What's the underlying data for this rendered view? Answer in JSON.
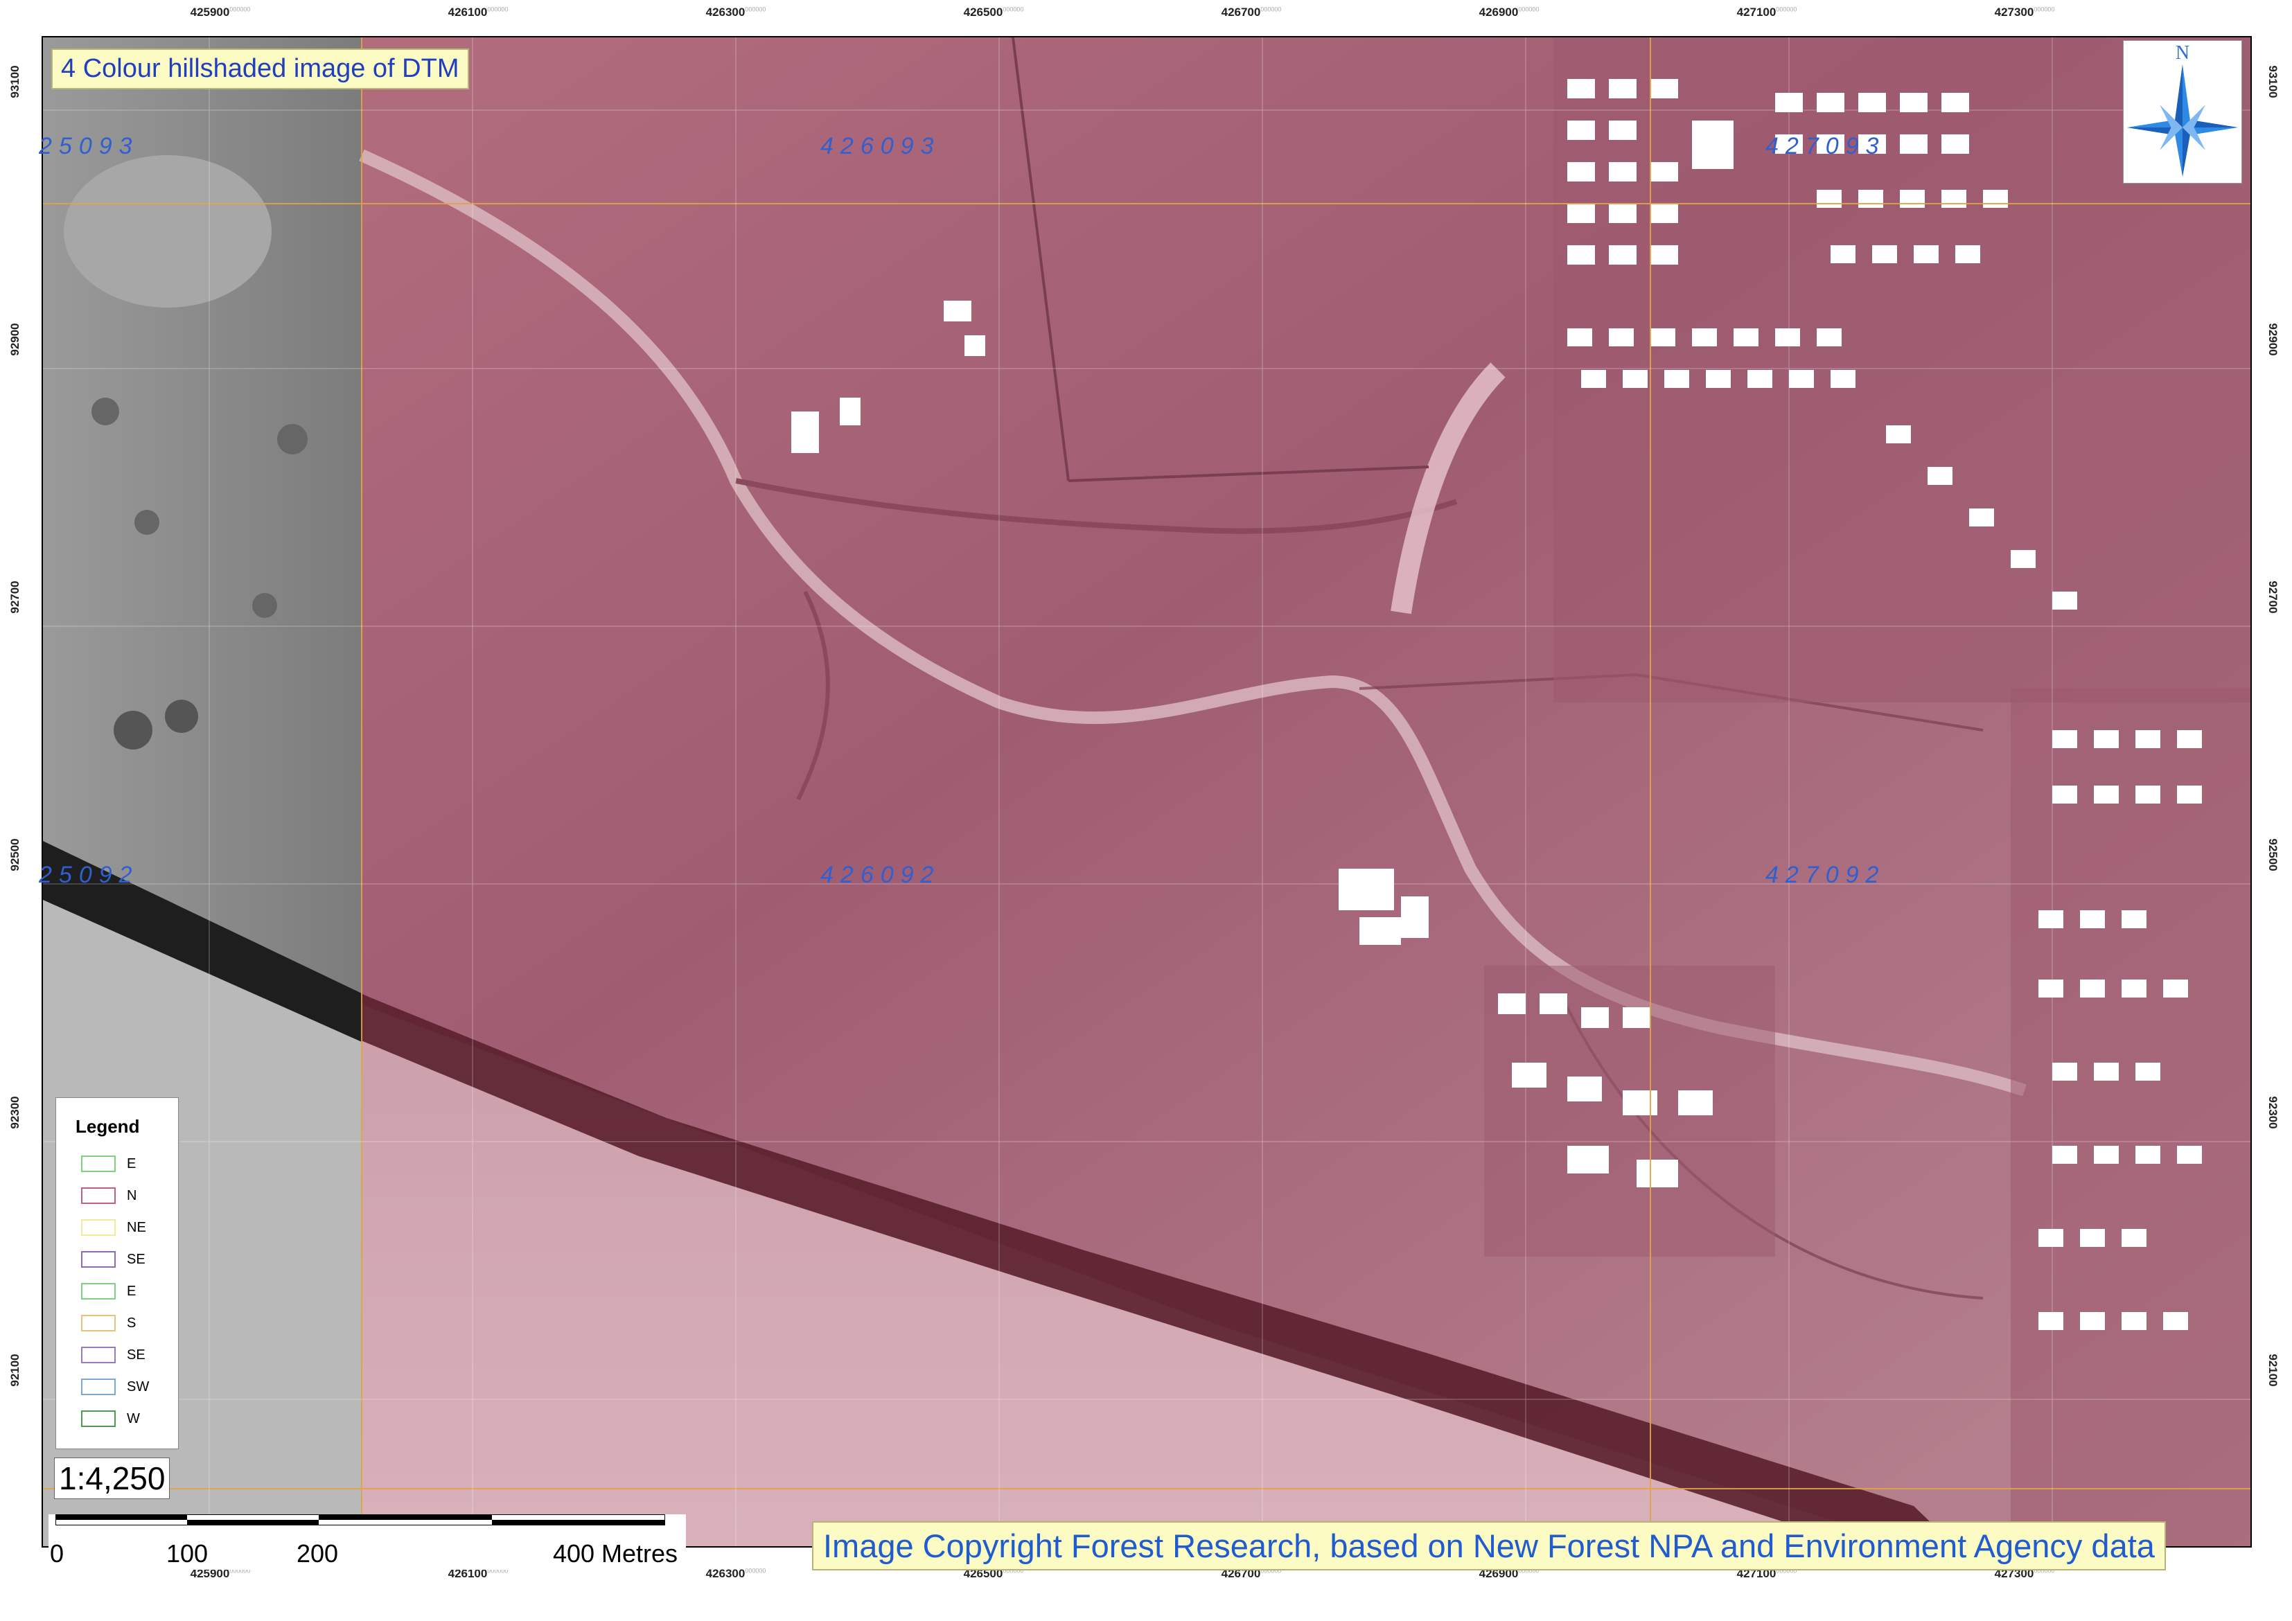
{
  "title": "4 Colour hillshaded image of DTM",
  "x_ticks": [
    "425900",
    "426100",
    "426300",
    "426500",
    "426700",
    "426900",
    "427100",
    "427300"
  ],
  "x_tick_suffix": "000000",
  "y_ticks": [
    "93100",
    "92900",
    "92700",
    "92500",
    "92300",
    "92100"
  ],
  "grid_labels": [
    "25093",
    "426093",
    "427093",
    "25092",
    "426092",
    "427092"
  ],
  "north_arrow_label": "N",
  "legend": {
    "title": "Legend",
    "items": [
      {
        "label": "E",
        "color": "#7fd07f"
      },
      {
        "label": "N",
        "color": "#c0607a"
      },
      {
        "label": "NE",
        "color": "#f0ec9a"
      },
      {
        "label": "SE",
        "color": "#8a6ab8"
      },
      {
        "label": "E",
        "color": "#7fd07f"
      },
      {
        "label": "S",
        "color": "#e9c27a"
      },
      {
        "label": "SE",
        "color": "#9a78c8"
      },
      {
        "label": "SW",
        "color": "#7aa8d8"
      },
      {
        "label": "W",
        "color": "#4f9a52"
      }
    ]
  },
  "scale": {
    "ratio": "1:4,250",
    "labels": [
      "0",
      "100",
      "200",
      "400 Metres"
    ]
  },
  "copyright": "Image Copyright Forest Research, based on New Forest NPA and Environment Agency data",
  "colors": {
    "terrain": "#a86478",
    "grayscale_strip": "#8a8a8a",
    "cliff": "#5a1f2c",
    "label_blue": "#2f5fd0"
  }
}
